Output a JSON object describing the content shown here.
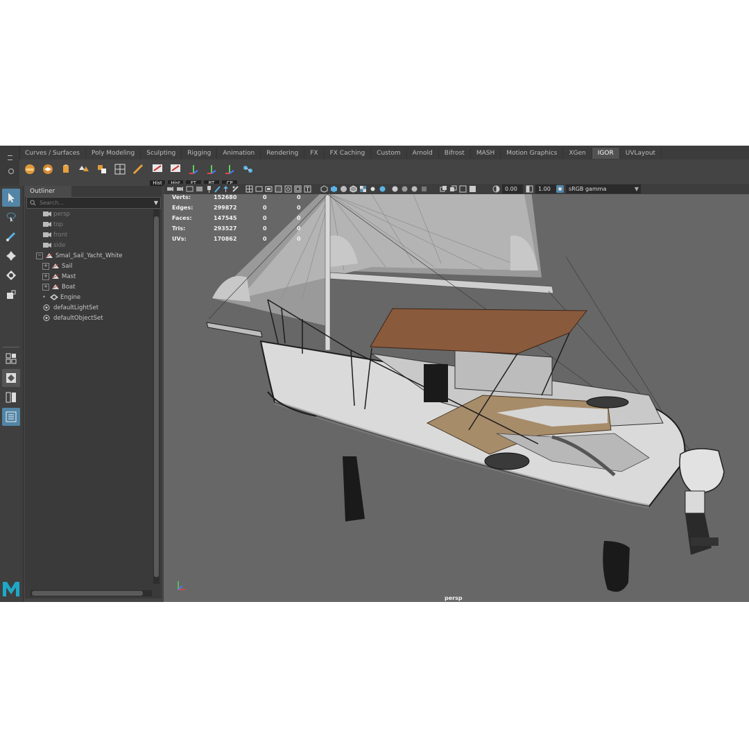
{
  "shelf": {
    "tabs": [
      "Curves / Surfaces",
      "Poly Modeling",
      "Sculpting",
      "Rigging",
      "Animation",
      "Rendering",
      "FX",
      "FX Caching",
      "Custom",
      "Arnold",
      "Bifrost",
      "MASH",
      "Motion Graphics",
      "XGen",
      "IGOR",
      "UVLayout"
    ],
    "active_tab": "IGOR",
    "icon_labels": [
      "Hist",
      "Hist",
      "FT",
      "RT",
      "CP"
    ]
  },
  "outliner": {
    "title": "Outliner",
    "search_placeholder": "Search...",
    "items": [
      {
        "label": "persp",
        "icon": "camera-icon"
      },
      {
        "label": "top",
        "icon": "camera-icon"
      },
      {
        "label": "front",
        "icon": "camera-icon"
      },
      {
        "label": "side",
        "icon": "camera-icon"
      },
      {
        "label": "Smal_Sail_Yacht_White",
        "icon": "mesh-icon"
      },
      {
        "label": "Sail",
        "icon": "mesh-icon"
      },
      {
        "label": "Mast",
        "icon": "mesh-icon"
      },
      {
        "label": "Boat",
        "icon": "mesh-icon"
      },
      {
        "label": "Engine",
        "icon": "transform-icon"
      },
      {
        "label": "defaultLightSet",
        "icon": "set-icon"
      },
      {
        "label": "defaultObjectSet",
        "icon": "set-icon"
      }
    ]
  },
  "viewport": {
    "exposure": "0.00",
    "gamma": "1.00",
    "color_space": "sRGB gamma",
    "camera": "persp",
    "hud": [
      {
        "label": "Verts:",
        "v1": "152680",
        "v2": "0",
        "v3": "0"
      },
      {
        "label": "Edges:",
        "v1": "299872",
        "v2": "0",
        "v3": "0"
      },
      {
        "label": "Faces:",
        "v1": "147545",
        "v2": "0",
        "v3": "0"
      },
      {
        "label": "Tris:",
        "v1": "293527",
        "v2": "0",
        "v3": "0"
      },
      {
        "label": "UVs:",
        "v1": "170862",
        "v2": "0",
        "v3": "0"
      }
    ]
  },
  "colors": {
    "accent": "#5285a6",
    "viewport_bg": "#676767",
    "bimini_brown": "#8a5a3c"
  }
}
